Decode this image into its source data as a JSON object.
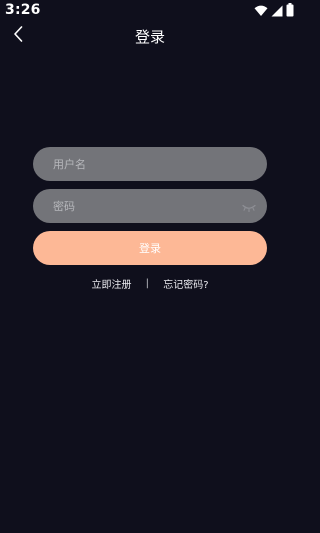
{
  "status_bar": {
    "time": "3:26",
    "icons": [
      "wifi-icon",
      "cell-signal-icon",
      "battery-icon"
    ]
  },
  "app_bar": {
    "back_icon": "chevron-left-icon",
    "title": "登录"
  },
  "form": {
    "username_placeholder": "用户名",
    "password_placeholder": "密码",
    "password_toggle_icon": "eye-closed-icon",
    "login_label": "登录"
  },
  "links": {
    "register": "立即注册",
    "divider": "|",
    "forgot_password": "忘记密码?"
  },
  "colors": {
    "background": "#0f0f1c",
    "field": "#737479",
    "primary_button": "#fdb896",
    "text": "#ffffff"
  }
}
